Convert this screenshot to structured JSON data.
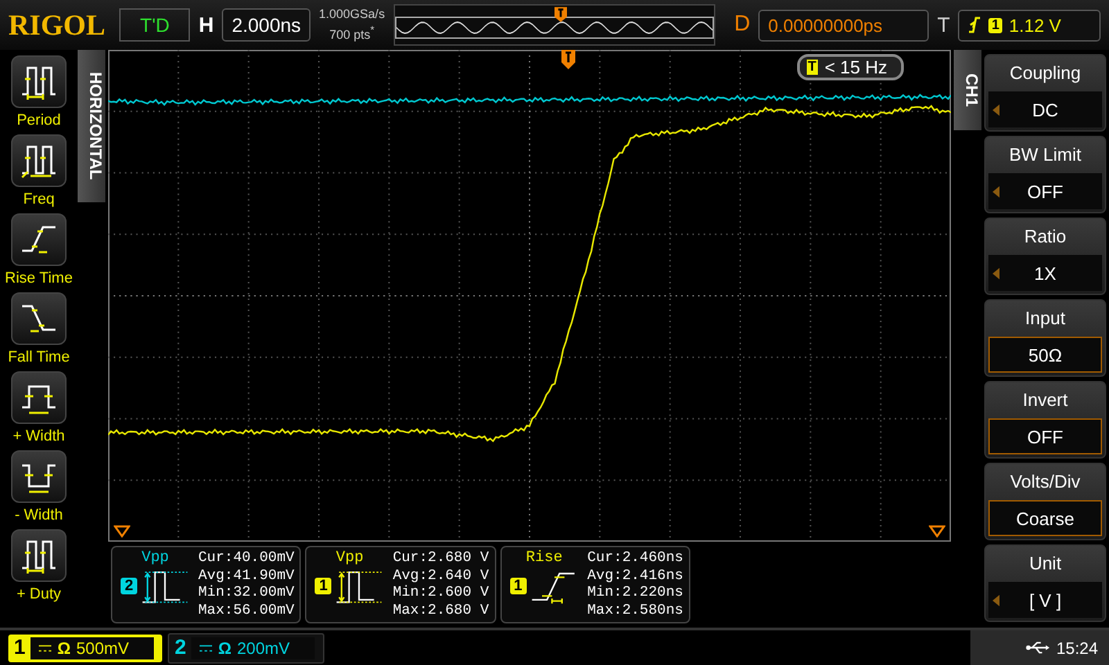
{
  "brand": "RIGOL",
  "run_state": "T'D",
  "horizontal": {
    "label": "H",
    "timebase": "2.000ns"
  },
  "acquisition": {
    "sample_rate": "1.000GSa/s",
    "memory_depth": "700 pts$^{*}$"
  },
  "delay": {
    "label": "D",
    "value": "0.00000000ps"
  },
  "trigger": {
    "label": "T",
    "source": "1",
    "level": "1.12 V"
  },
  "horizontal_tab": "HORIZONTAL",
  "measure_menu": [
    {
      "label": "Period",
      "kind": "period"
    },
    {
      "label": "Freq",
      "kind": "freq"
    },
    {
      "label": "Rise Time",
      "kind": "rise"
    },
    {
      "label": "Fall Time",
      "kind": "fall"
    },
    {
      "label": "+ Width",
      "kind": "pwidth"
    },
    {
      "label": "- Width",
      "kind": "nwidth"
    },
    {
      "label": "+ Duty",
      "kind": "duty"
    }
  ],
  "trigger_frequency": {
    "badge": "T",
    "value": "< 15 Hz"
  },
  "channel_tab": "CH1",
  "channel_menu": [
    {
      "title": "Coupling",
      "value": "DC",
      "kind": "select"
    },
    {
      "title": "BW Limit",
      "value": "OFF",
      "kind": "select"
    },
    {
      "title": "Ratio",
      "value": "1X",
      "kind": "select"
    },
    {
      "title": "Input",
      "value": "50Ω",
      "kind": "toggle"
    },
    {
      "title": "Invert",
      "value": "OFF",
      "kind": "toggle"
    },
    {
      "title": "Volts/Div",
      "value": "Coarse",
      "kind": "toggle"
    },
    {
      "title": "Unit",
      "value": "[  V  ]",
      "kind": "select"
    }
  ],
  "measurements": [
    {
      "name": "Vpp",
      "channel": "2",
      "color": "#00d5e0",
      "kind": "pulse",
      "readings": [
        "Cur:40.00mV",
        "Avg:41.90mV",
        "Min:32.00mV",
        "Max:56.00mV"
      ]
    },
    {
      "name": "Vpp",
      "channel": "1",
      "color": "#f0f000",
      "kind": "pulse",
      "readings": [
        "Cur:2.680 V",
        "Avg:2.640 V",
        "Min:2.600 V",
        "Max:2.680 V"
      ]
    },
    {
      "name": "Rise",
      "channel": "1",
      "color": "#f0f000",
      "kind": "rise",
      "readings": [
        "Cur:2.460ns",
        "Avg:2.416ns",
        "Min:2.220ns",
        "Max:2.580ns"
      ]
    }
  ],
  "channels": [
    {
      "number": "1",
      "impedance": "Ω",
      "scale": "500mV",
      "selected": true,
      "color": "#f0f000"
    },
    {
      "number": "2",
      "impedance": "Ω",
      "scale": "200mV",
      "selected": false,
      "color": "#00d5e0"
    }
  ],
  "status": {
    "time": "15:24"
  }
}
